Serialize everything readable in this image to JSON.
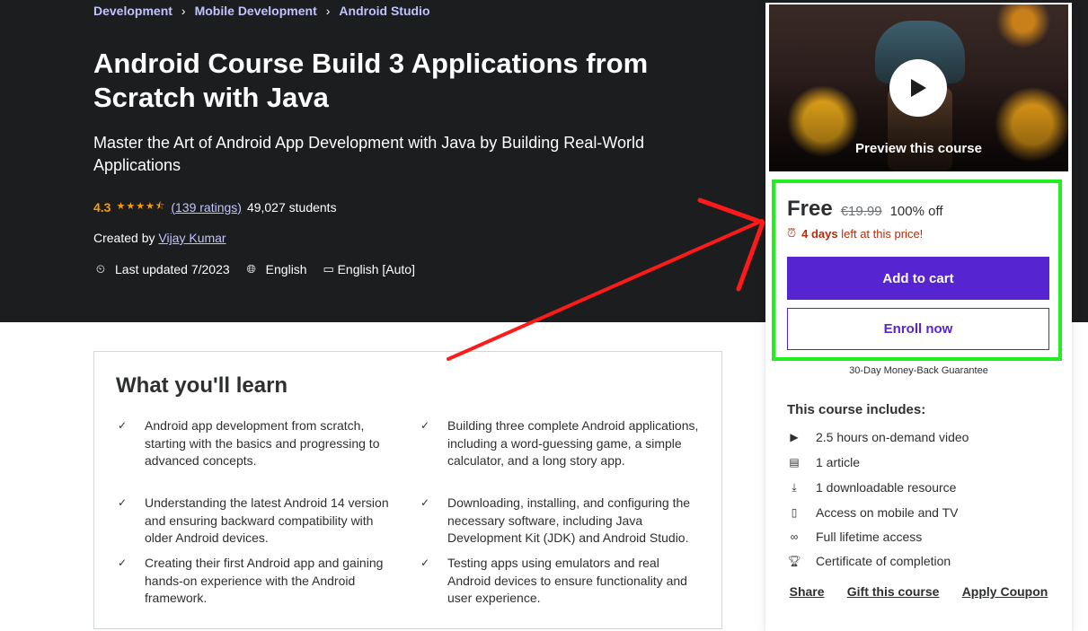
{
  "breadcrumb": [
    "Development",
    "Mobile Development",
    "Android Studio"
  ],
  "course": {
    "title": "Android Course Build 3 Applications from Scratch with Java",
    "subtitle": "Master the Art of Android App Development with Java by Building Real-World Applications",
    "rating": "4.3",
    "stars": "★★★★⯪",
    "ratings_count": "(139 ratings)",
    "students": "49,027 students",
    "created_by_label": "Created by",
    "instructor": "Vijay Kumar",
    "last_updated": "Last updated 7/2023",
    "language": "English",
    "captions": "English [Auto]"
  },
  "learn": {
    "title": "What you'll learn",
    "items": [
      "Android app development from scratch, starting with the basics and progressing to advanced concepts.",
      "Building three complete Android applications, including a word-guessing game, a simple calculator, and a long story app.",
      "Understanding the latest Android 14 version and ensuring backward compatibility with older Android devices.",
      "Downloading, installing, and configuring the necessary software, including Java Development Kit (JDK) and Android Studio.",
      "Creating their first Android app and gaining hands-on experience with the Android framework.",
      "Testing apps using emulators and real Android devices to ensure functionality and user experience."
    ]
  },
  "sidebar": {
    "preview_label": "Preview this course",
    "price": "Free",
    "original_price": "€19.99",
    "discount": "100% off",
    "timer_days": "4 days",
    "timer_rest": "left at this price!",
    "add_to_cart": "Add to cart",
    "enroll_now": "Enroll now",
    "guarantee": "30-Day Money-Back Guarantee",
    "includes_title": "This course includes:",
    "includes": [
      {
        "icon": "video-icon",
        "text": "2.5 hours on-demand video"
      },
      {
        "icon": "article-icon",
        "text": "1 article"
      },
      {
        "icon": "download-icon",
        "text": "1 downloadable resource"
      },
      {
        "icon": "mobile-icon",
        "text": "Access on mobile and TV"
      },
      {
        "icon": "infinity-icon",
        "text": "Full lifetime access"
      },
      {
        "icon": "trophy-icon",
        "text": "Certificate of completion"
      }
    ],
    "links": [
      "Share",
      "Gift this course",
      "Apply Coupon"
    ]
  },
  "colors": {
    "hero_bg": "#1c1d1f",
    "accent": "#5624d0",
    "star": "#f69c08",
    "link_lilac": "#c0c4fc",
    "highlight": "#22ee22",
    "annotation_arrow": "#ff1a1a"
  }
}
